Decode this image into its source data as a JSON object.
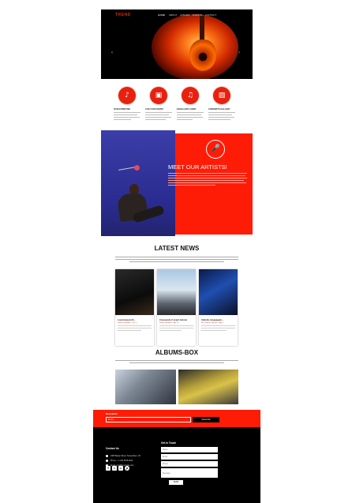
{
  "header": {
    "logo": "TREND",
    "nav": [
      "HOME",
      "ABOUT",
      "ALBUMS",
      "EVENTS",
      "CONTACT"
    ],
    "prev_arrow": "‹",
    "next_arrow": "›"
  },
  "features": [
    {
      "title": "OUR EXPERTISE",
      "icon": "♪"
    },
    {
      "title": "LIVE FUN EVENTS",
      "icon": "▣"
    },
    {
      "title": "EXCELLENT AUDIO",
      "icon": "♫"
    },
    {
      "title": "CONCERTS GALLERY",
      "icon": "▨"
    }
  ],
  "artists": {
    "title": "MEET OUR ARTISTS!",
    "mic_icon": "🎤"
  },
  "news": {
    "title": "LATEST NEWS",
    "cards": [
      {
        "title": "Lorem Ipsum D...",
        "meta": "Darren Gonzalez · Jun 1"
      },
      {
        "title": "Crescendo Z event Alomei",
        "meta": "Daren Gonzalez · Apr 10"
      },
      {
        "title": "Xdentis Linguagum...",
        "meta": "Mc Concert Concerts · Apr 6"
      }
    ]
  },
  "albums": {
    "title": "ALBUMS-BOX"
  },
  "newsletter": {
    "label": "Newsletter",
    "placeholder": "Email...",
    "button": "Subscribe"
  },
  "contact": {
    "title": "Contact Us",
    "rows": [
      "1905 Bayby Street, Somewhere, NY",
      "Phone: + 1 234 5678 9012",
      "Email: email@example.com"
    ],
    "social": [
      "f",
      "t",
      "in",
      "p"
    ]
  },
  "get_in_touch": {
    "title": "Get In Touch",
    "name_placeholder": "Name",
    "email_placeholder": "Email",
    "phone_placeholder": "Phone",
    "message_placeholder": "Message",
    "send": "SEND"
  },
  "colors": {
    "accent": "#ff1c06",
    "dark": "#000000"
  }
}
